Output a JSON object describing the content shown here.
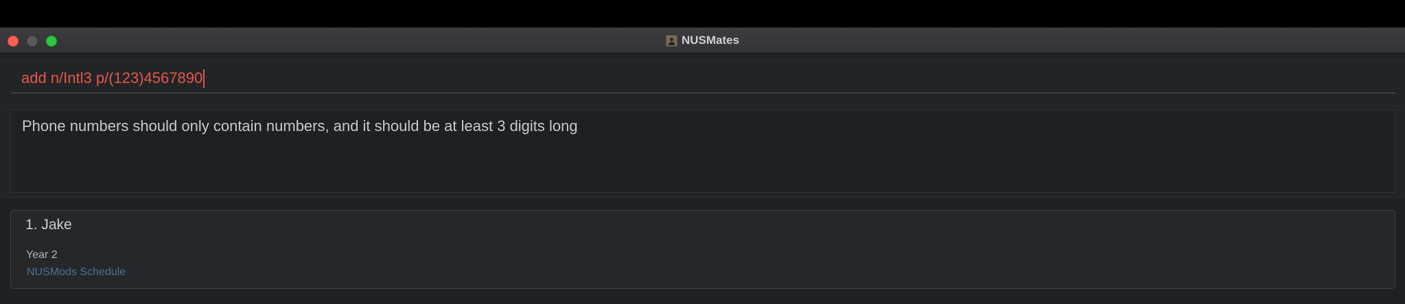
{
  "window": {
    "title": "NUSMates",
    "app_icon": "contact-book-icon"
  },
  "command_box": {
    "value": "add n/Intl3 p/(123)4567890",
    "text_color": "#e5574a"
  },
  "result_display": {
    "message": "Phone numbers should only contain numbers, and it should be at least 3 digits long"
  },
  "person_list": {
    "items": [
      {
        "index_name": "1. Jake",
        "year": "Year 2",
        "link_label": "NUSMods Schedule"
      }
    ]
  },
  "colors": {
    "close": "#ff5f57",
    "minimize": "#5a5a5c",
    "maximize": "#28c840",
    "background": "#1f2022",
    "link": "#4f7191"
  }
}
